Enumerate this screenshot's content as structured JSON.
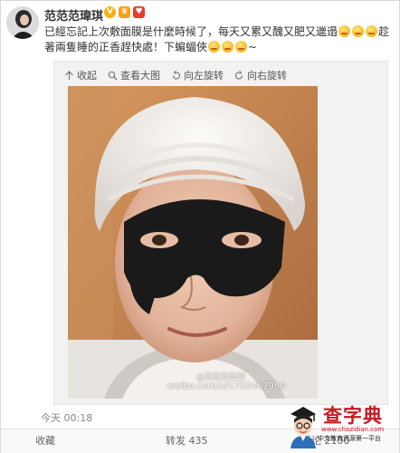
{
  "post": {
    "username": "范范范瑋琪",
    "badges": [
      "V",
      "♛",
      "♥"
    ],
    "text_parts": [
      "已經忘記上次敷面膜是什麼時候了，每天又累又醜又肥又邋遢",
      "趁著兩隻睡的正香趕快處！下蝙蝠俠",
      "~"
    ],
    "emoji_1_count": 3,
    "emoji_2_count": 3
  },
  "toolbar": {
    "collapse": "收起",
    "view_large": "查看大图",
    "rotate_left": "向左旋转",
    "rotate_right": "向右旋转"
  },
  "photo": {
    "watermark_line1": "@范范范瑋琪",
    "watermark_line2": "weibo.com/u/1752467960"
  },
  "time": "今天 00:18",
  "actions": {
    "collect": "收藏",
    "forward": "转发 435",
    "comment": "评论 2100"
  },
  "logo": {
    "title": "查字典",
    "url": "www.chazidian.com",
    "subtitle": "中文教育资源第一平台"
  }
}
